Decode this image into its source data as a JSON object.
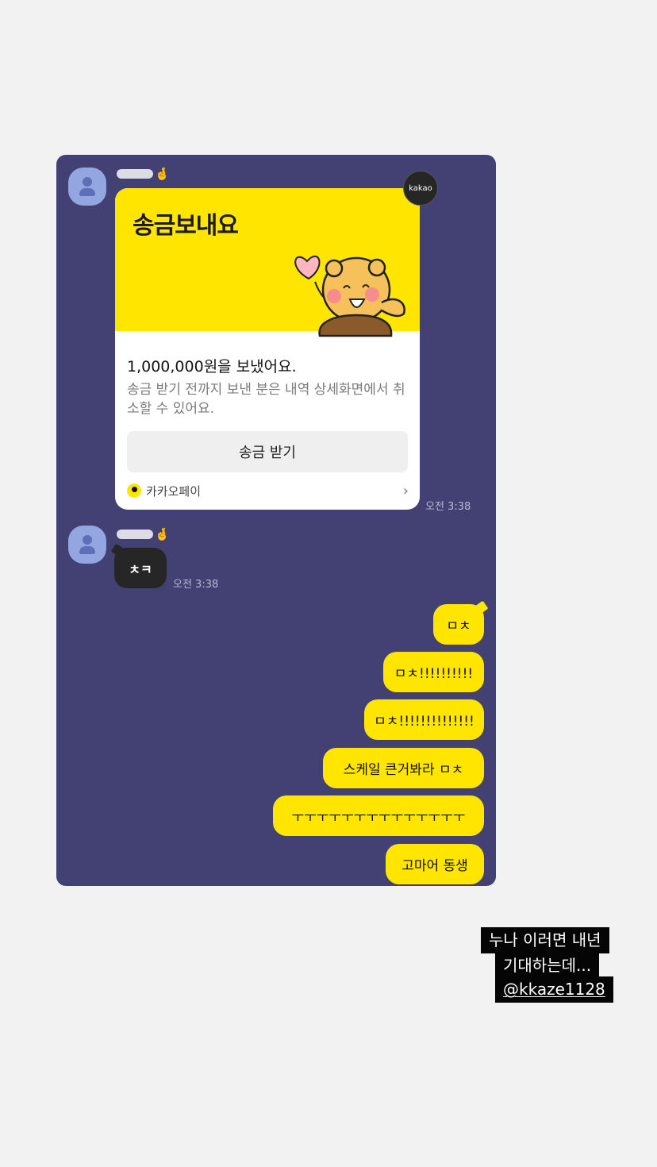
{
  "chat": {
    "messages": {
      "card": {
        "title": "송금보내요",
        "badge": "kakao",
        "amount": "1,000,000원을 보냈어요.",
        "description": "송금 받기 전까지 보낸 분은 내역 상세화면에서 취소할 수 있어요.",
        "button": "송금 받기",
        "footer": "카카오페이",
        "footer_chevron": "›",
        "time": "오전 3:38"
      },
      "reply": {
        "text": "ㅊㅋ",
        "time": "오전 3:38"
      },
      "mine": [
        "ㅁㅊ",
        "ㅁㅊ!!!!!!!!!!",
        "ㅁㅊ!!!!!!!!!!!!!!",
        "스케일 큰거봐라 ㅁㅊ",
        "ㅜㅜㅜㅜㅜㅜㅜㅜㅜㅜㅜㅜㅜㅜ",
        "고마어 동생"
      ]
    },
    "sender_emoji": "🤞"
  },
  "caption": {
    "line1": "누나 이러면 내년",
    "line2": "기대하는데...",
    "mention": "@kkaze1128"
  },
  "colors": {
    "chat_bg": "#434173",
    "kakao_yellow": "#ffe500",
    "page_bg": "#f2f2f2"
  },
  "icons": [
    "profile-avatar-icon",
    "kakaopay-icon",
    "chevron-right-icon"
  ]
}
